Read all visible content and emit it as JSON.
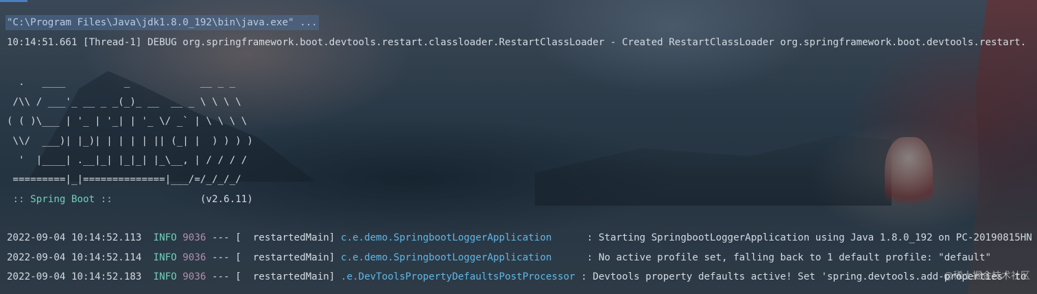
{
  "console": {
    "command": "\"C:\\Program Files\\Java\\jdk1.8.0_192\\bin\\java.exe\" ...",
    "debug_line": "10:14:51.661 [Thread-1] DEBUG org.springframework.boot.devtools.restart.classloader.RestartClassLoader - Created RestartClassLoader org.springframework.boot.devtools.restart.",
    "banner": [
      "  .   ____          _            __ _ _",
      " /\\\\ / ___'_ __ _ _(_)_ __  __ _ \\ \\ \\ \\",
      "( ( )\\___ | '_ | '_| | '_ \\/ _` | \\ \\ \\ \\",
      " \\\\/  ___)| |_)| | | | | || (_| |  ) ) ) )",
      "  '  |____| .__|_| |_|_| |_\\__, | / / / /",
      " =========|_|==============|___/=/_/_/_/"
    ],
    "spring_label": " :: Spring Boot :: ",
    "spring_version": "              (v2.6.11)",
    "logs": [
      {
        "timestamp": "2022-09-04 10:14:52.113",
        "level": "  INFO",
        "pid": " 9036",
        "sep": " --- [  restartedMain] ",
        "logger": "c.e.demo.SpringbootLoggerApplication     ",
        "message": " : Starting SpringbootLoggerApplication using Java 1.8.0_192 on PC-20190815HN"
      },
      {
        "timestamp": "2022-09-04 10:14:52.114",
        "level": "  INFO",
        "pid": " 9036",
        "sep": " --- [  restartedMain] ",
        "logger": "c.e.demo.SpringbootLoggerApplication     ",
        "message": " : No active profile set, falling back to 1 default profile: \"default\""
      },
      {
        "timestamp": "2022-09-04 10:14:52.183",
        "level": "  INFO",
        "pid": " 9036",
        "sep": " --- [  restartedMain] ",
        "logger": ".e.DevToolsPropertyDefaultsPostProcessor",
        "message": " : Devtools property defaults active! Set 'spring.devtools.add-properties' to"
      }
    ]
  },
  "watermark": "@稀土掘金技术社区",
  "colors": {
    "info": "#6fd1ba",
    "pid": "#b48ead",
    "logger": "#5fb7e6",
    "command_bg": "#4e6e96"
  }
}
